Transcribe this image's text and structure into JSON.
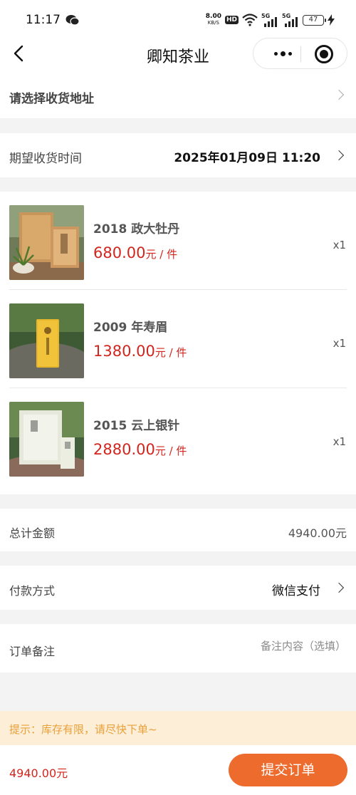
{
  "status_bar": {
    "time": "11:17",
    "net_speed_value": "8.00",
    "net_speed_unit": "KB/S",
    "hd_label": "HD",
    "signal1": "5G",
    "signal2": "5G",
    "battery": "47"
  },
  "nav": {
    "title": "卿知茶业"
  },
  "address": {
    "label": "请选择收货地址"
  },
  "delivery_time": {
    "label": "期望收货时间",
    "value": "2025年01月09日 11:20"
  },
  "products": [
    {
      "name": "2018 政大牡丹",
      "price": "680.00",
      "unit": "元 / 件",
      "qty": "x1"
    },
    {
      "name": "2009 年寿眉",
      "price": "1380.00",
      "unit": "元 / 件",
      "qty": "x1"
    },
    {
      "name": "2015 云上银针",
      "price": "2880.00",
      "unit": "元 / 件",
      "qty": "x1"
    }
  ],
  "summary": {
    "total_label": "总计金额",
    "total_value": "4940.00元"
  },
  "payment": {
    "label": "付款方式",
    "value": "微信支付"
  },
  "remark": {
    "label": "订单备注",
    "placeholder": "备注内容（选填）"
  },
  "tip": {
    "text": "提示：库存有限，请尽快下单~"
  },
  "bottom": {
    "total": "4940.00元",
    "submit_label": "提交订单"
  },
  "colors": {
    "price_red": "#d3251e",
    "submit_orange": "#ec6b2d",
    "tip_bg": "#fdeed7",
    "tip_text": "#e9a039"
  }
}
